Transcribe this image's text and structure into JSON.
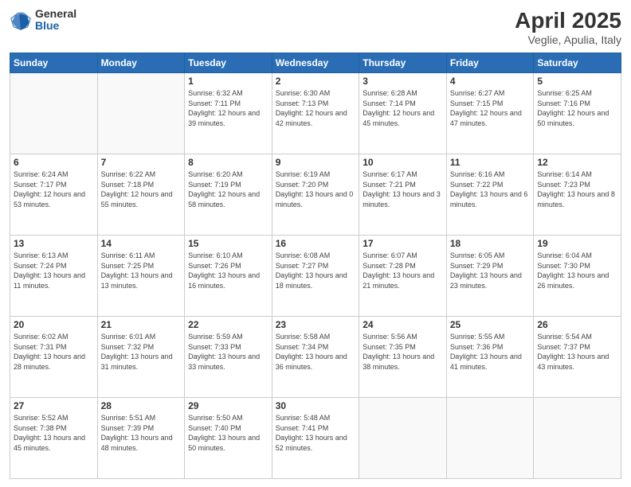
{
  "header": {
    "logo_general": "General",
    "logo_blue": "Blue",
    "title": "April 2025",
    "subtitle": "Veglie, Apulia, Italy"
  },
  "columns": [
    "Sunday",
    "Monday",
    "Tuesday",
    "Wednesday",
    "Thursday",
    "Friday",
    "Saturday"
  ],
  "weeks": [
    [
      {
        "day": "",
        "info": ""
      },
      {
        "day": "",
        "info": ""
      },
      {
        "day": "1",
        "info": "Sunrise: 6:32 AM\nSunset: 7:11 PM\nDaylight: 12 hours\nand 39 minutes."
      },
      {
        "day": "2",
        "info": "Sunrise: 6:30 AM\nSunset: 7:13 PM\nDaylight: 12 hours\nand 42 minutes."
      },
      {
        "day": "3",
        "info": "Sunrise: 6:28 AM\nSunset: 7:14 PM\nDaylight: 12 hours\nand 45 minutes."
      },
      {
        "day": "4",
        "info": "Sunrise: 6:27 AM\nSunset: 7:15 PM\nDaylight: 12 hours\nand 47 minutes."
      },
      {
        "day": "5",
        "info": "Sunrise: 6:25 AM\nSunset: 7:16 PM\nDaylight: 12 hours\nand 50 minutes."
      }
    ],
    [
      {
        "day": "6",
        "info": "Sunrise: 6:24 AM\nSunset: 7:17 PM\nDaylight: 12 hours\nand 53 minutes."
      },
      {
        "day": "7",
        "info": "Sunrise: 6:22 AM\nSunset: 7:18 PM\nDaylight: 12 hours\nand 55 minutes."
      },
      {
        "day": "8",
        "info": "Sunrise: 6:20 AM\nSunset: 7:19 PM\nDaylight: 12 hours\nand 58 minutes."
      },
      {
        "day": "9",
        "info": "Sunrise: 6:19 AM\nSunset: 7:20 PM\nDaylight: 13 hours\nand 0 minutes."
      },
      {
        "day": "10",
        "info": "Sunrise: 6:17 AM\nSunset: 7:21 PM\nDaylight: 13 hours\nand 3 minutes."
      },
      {
        "day": "11",
        "info": "Sunrise: 6:16 AM\nSunset: 7:22 PM\nDaylight: 13 hours\nand 6 minutes."
      },
      {
        "day": "12",
        "info": "Sunrise: 6:14 AM\nSunset: 7:23 PM\nDaylight: 13 hours\nand 8 minutes."
      }
    ],
    [
      {
        "day": "13",
        "info": "Sunrise: 6:13 AM\nSunset: 7:24 PM\nDaylight: 13 hours\nand 11 minutes."
      },
      {
        "day": "14",
        "info": "Sunrise: 6:11 AM\nSunset: 7:25 PM\nDaylight: 13 hours\nand 13 minutes."
      },
      {
        "day": "15",
        "info": "Sunrise: 6:10 AM\nSunset: 7:26 PM\nDaylight: 13 hours\nand 16 minutes."
      },
      {
        "day": "16",
        "info": "Sunrise: 6:08 AM\nSunset: 7:27 PM\nDaylight: 13 hours\nand 18 minutes."
      },
      {
        "day": "17",
        "info": "Sunrise: 6:07 AM\nSunset: 7:28 PM\nDaylight: 13 hours\nand 21 minutes."
      },
      {
        "day": "18",
        "info": "Sunrise: 6:05 AM\nSunset: 7:29 PM\nDaylight: 13 hours\nand 23 minutes."
      },
      {
        "day": "19",
        "info": "Sunrise: 6:04 AM\nSunset: 7:30 PM\nDaylight: 13 hours\nand 26 minutes."
      }
    ],
    [
      {
        "day": "20",
        "info": "Sunrise: 6:02 AM\nSunset: 7:31 PM\nDaylight: 13 hours\nand 28 minutes."
      },
      {
        "day": "21",
        "info": "Sunrise: 6:01 AM\nSunset: 7:32 PM\nDaylight: 13 hours\nand 31 minutes."
      },
      {
        "day": "22",
        "info": "Sunrise: 5:59 AM\nSunset: 7:33 PM\nDaylight: 13 hours\nand 33 minutes."
      },
      {
        "day": "23",
        "info": "Sunrise: 5:58 AM\nSunset: 7:34 PM\nDaylight: 13 hours\nand 36 minutes."
      },
      {
        "day": "24",
        "info": "Sunrise: 5:56 AM\nSunset: 7:35 PM\nDaylight: 13 hours\nand 38 minutes."
      },
      {
        "day": "25",
        "info": "Sunrise: 5:55 AM\nSunset: 7:36 PM\nDaylight: 13 hours\nand 41 minutes."
      },
      {
        "day": "26",
        "info": "Sunrise: 5:54 AM\nSunset: 7:37 PM\nDaylight: 13 hours\nand 43 minutes."
      }
    ],
    [
      {
        "day": "27",
        "info": "Sunrise: 5:52 AM\nSunset: 7:38 PM\nDaylight: 13 hours\nand 45 minutes."
      },
      {
        "day": "28",
        "info": "Sunrise: 5:51 AM\nSunset: 7:39 PM\nDaylight: 13 hours\nand 48 minutes."
      },
      {
        "day": "29",
        "info": "Sunrise: 5:50 AM\nSunset: 7:40 PM\nDaylight: 13 hours\nand 50 minutes."
      },
      {
        "day": "30",
        "info": "Sunrise: 5:48 AM\nSunset: 7:41 PM\nDaylight: 13 hours\nand 52 minutes."
      },
      {
        "day": "",
        "info": ""
      },
      {
        "day": "",
        "info": ""
      },
      {
        "day": "",
        "info": ""
      }
    ]
  ]
}
